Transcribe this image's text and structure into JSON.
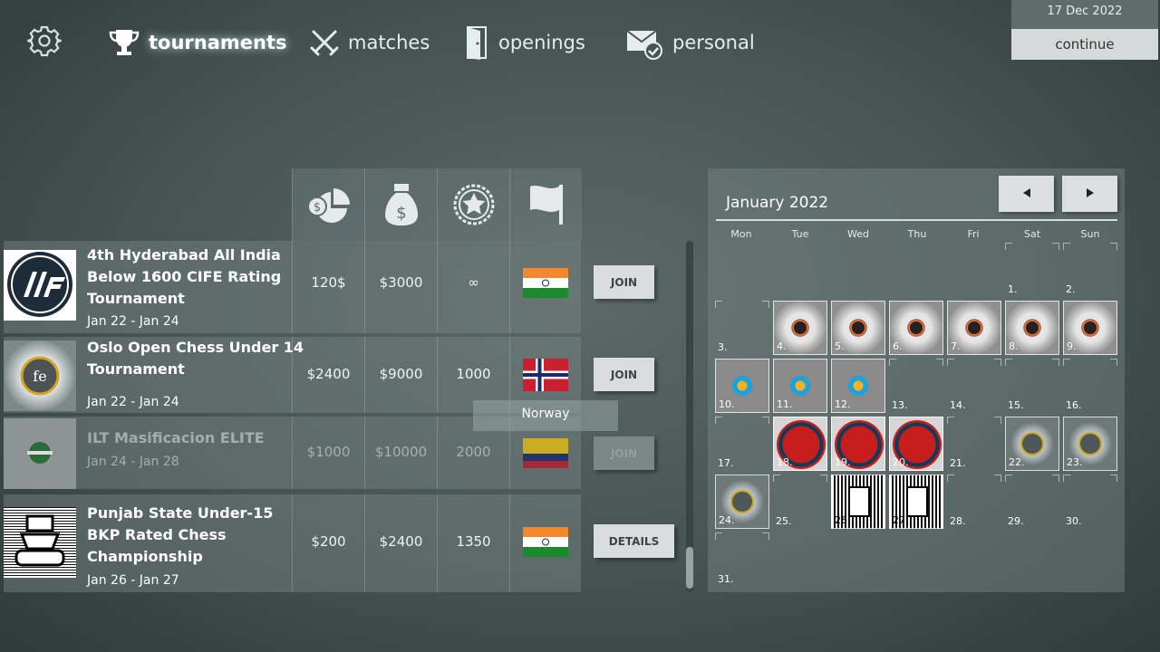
{
  "nav": {
    "items": [
      {
        "label": "tournaments",
        "icon": "trophy-icon",
        "active": true
      },
      {
        "label": "matches",
        "icon": "crossed-swords-icon",
        "active": false
      },
      {
        "label": "openings",
        "icon": "door-icon",
        "active": false
      },
      {
        "label": "personal",
        "icon": "mail-check-icon",
        "active": false
      }
    ]
  },
  "top_right": {
    "date": "17 Dec 2022",
    "continue_label": "continue"
  },
  "table": {
    "header_icons": [
      "pie-coin-icon",
      "money-bag-icon",
      "rating-star-icon",
      "flag-icon"
    ],
    "rows": [
      {
        "title_lines": [
          "4th Hyderabad All India",
          "Below 1600  CIFE Rating",
          "Tournament"
        ],
        "dates": "Jan 22 - Jan 24",
        "fee": "120$",
        "prize": "$3000",
        "rating": "∞",
        "flag": "india-flag",
        "button": "JOIN",
        "enabled": true
      },
      {
        "title_lines": [
          "Oslo Open Chess Under 14",
          "Tournament"
        ],
        "dates": "Jan 22 - Jan 24",
        "fee": "$2400",
        "prize": "$9000",
        "rating": "1000",
        "flag": "norway-flag",
        "button": "JOIN",
        "enabled": true
      },
      {
        "title_lines": [
          "ILT  Masificacion ELITE"
        ],
        "dates": "Jan 24 - Jan 28",
        "fee": "$1000",
        "prize": "$10000",
        "rating": "2000",
        "flag": "colombia-flag",
        "button": "JOIN",
        "enabled": false
      },
      {
        "title_lines": [
          "Punjab State Under-15",
          "BKP  Rated Chess",
          "Championship"
        ],
        "dates": "Jan 26 - Jan 27",
        "fee": "$200",
        "prize": "$2400",
        "rating": "1350",
        "flag": "india-flag",
        "button": "DETAILS",
        "enabled": true
      }
    ],
    "tooltip": "Norway"
  },
  "calendar": {
    "month": "January 2022",
    "prev_icon": "arrow-left-icon",
    "next_icon": "arrow-right-icon",
    "weekdays": [
      "Mon",
      "Tue",
      "Wed",
      "Thu",
      "Fri",
      "Sat",
      "Sun"
    ],
    "days": [
      "1.",
      "2.",
      "3.",
      "4.",
      "5.",
      "6.",
      "7.",
      "8.",
      "9.",
      "10.",
      "11.",
      "12.",
      "13.",
      "14.",
      "15.",
      "16.",
      "17.",
      "18.",
      "19.",
      "20.",
      "21.",
      "22.",
      "23.",
      "24.",
      "25.",
      "26.",
      "27.",
      "28.",
      "29.",
      "30.",
      "31."
    ]
  }
}
